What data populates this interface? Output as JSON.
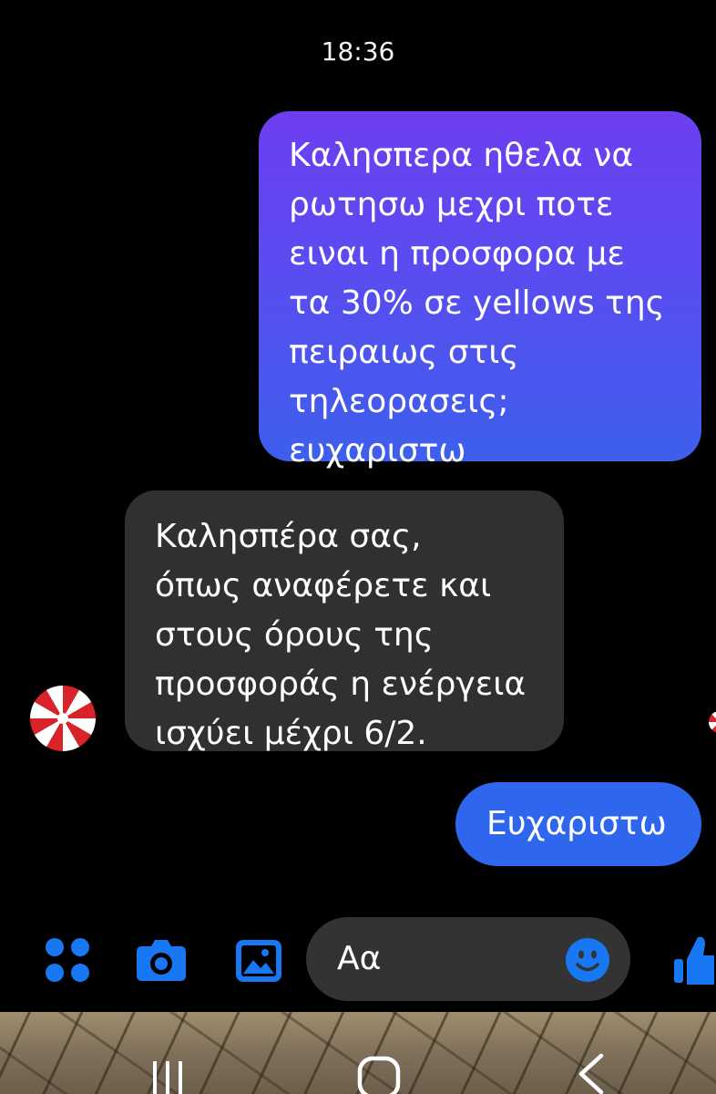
{
  "chat": {
    "timestamp": "18:36",
    "messages": [
      {
        "direction": "outgoing",
        "text": "Καλησπερα ηθελα να\nρωτησω μεχρι ποτε\nειναι η προσφορα με\nτα 30% σε yellows της\nπειραιως στις\nτηλεορασεις;\nευχαριστω"
      },
      {
        "direction": "incoming",
        "text": "Καλησπέρα σας,\nόπως αναφέρετε και\nστους όρους της\nπροσφοράς η ενέργεια\nισχύει μέχρι 6/2."
      },
      {
        "direction": "outgoing",
        "text": "Ευχαριστω"
      }
    ]
  },
  "composer": {
    "placeholder": "Αα",
    "icons": [
      "apps-icon",
      "camera-icon",
      "gallery-icon",
      "emoji-icon",
      "like-icon"
    ]
  },
  "nav": {
    "icons": [
      "recent-apps-icon",
      "home-icon",
      "back-icon"
    ]
  },
  "colors": {
    "background": "#000000",
    "outgoing_gradient_top": "#6d3ef0",
    "outgoing_gradient_bottom": "#3d5fec",
    "outgoing_solid": "#2f66ee",
    "incoming": "#303030",
    "accent": "#1877f2",
    "input": "#333333"
  }
}
